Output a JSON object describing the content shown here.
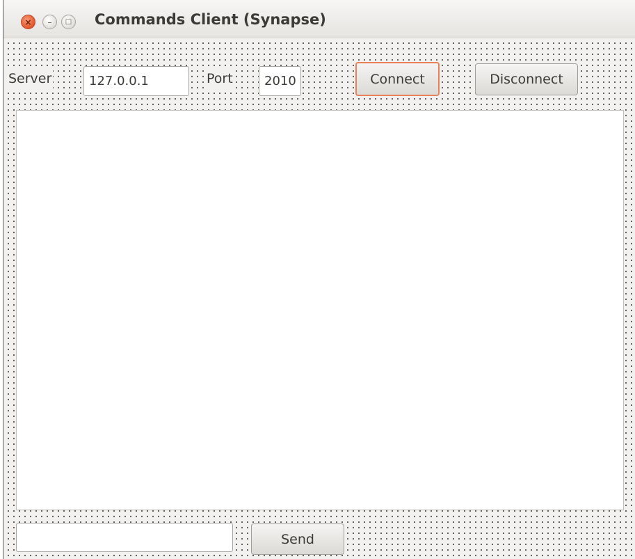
{
  "window": {
    "title": "Commands Client (Synapse)",
    "close_glyph": "×",
    "minimize_glyph": "–",
    "maximize_glyph": "□"
  },
  "connection": {
    "server_label": "Server",
    "server_value": "127.0.0.1",
    "port_label": "Port",
    "port_value": "2010",
    "connect_label": "Connect",
    "disconnect_label": "Disconnect"
  },
  "output": {
    "text": ""
  },
  "command": {
    "input_value": "",
    "send_label": "Send"
  },
  "colors": {
    "focus_accent": "#e8805a",
    "close_button": "#e2572b"
  }
}
